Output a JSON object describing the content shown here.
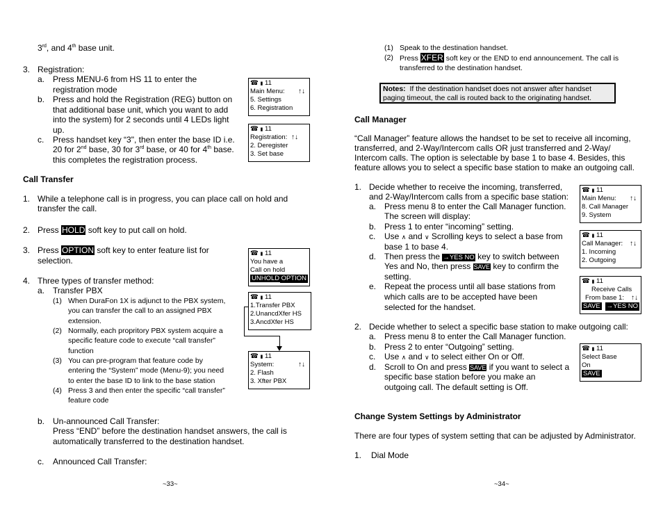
{
  "left_page": {
    "intro_line": {
      "prefix": "3",
      "sup1": "rd",
      "mid": ", and 4",
      "sup2": "th",
      "suffix": " base unit."
    },
    "registration": {
      "num": "3.",
      "title": "Registration:",
      "a": {
        "label": "a.",
        "lines": [
          "Press MENU-6 from HS 11 to enter the",
          "registration mode"
        ]
      },
      "b": {
        "label": "b.",
        "lines": [
          "Press and hold the Registration (REG) button on",
          "that additional base unit, which you want to add",
          "into the system) for 2 seconds until 4 LEDs light",
          "up."
        ]
      },
      "c": {
        "label": "c.",
        "line1": "Press handset key “3\", then enter the base ID i.e.",
        "line2": {
          "t1": "20 for 2",
          "s1": "nd",
          "t2": " base, 30 for 3",
          "s2": "rd",
          "t3": " base, or 40 for 4",
          "s3": "th",
          "t4": " base."
        },
        "line3": "this completes the registration process."
      }
    },
    "call_transfer": {
      "heading": "Call Transfer",
      "item1": {
        "num": "1.",
        "lines": [
          " While a telephone call is in progress, you can place call on hold and",
          "transfer the call."
        ]
      },
      "item2": {
        "num": "2.",
        "pre": "Press ",
        "key": "HOLD",
        "post": " soft key to put call on hold."
      },
      "item3": {
        "num": "3.",
        "pre": "Press ",
        "key": "OPTION",
        "post": " soft key to enter feature list for",
        "line2": "selection."
      },
      "item4": {
        "num": "4.",
        "text": "Three types of transfer method:"
      },
      "a": {
        "label": "a.",
        "title": "Transfer PBX",
        "subs": [
          {
            "num": "(1)",
            "lines": [
              "When DuraFon 1X is adjunct to the PBX system,",
              "you can transfer the call to an assigned PBX",
              "extension."
            ]
          },
          {
            "num": "(2)",
            "lines": [
              "Normally, each propritory PBX system acquire a",
              "specific feature code to execute “call transfer”",
              "function"
            ]
          },
          {
            "num": "(3)",
            "lines": [
              "You can pre-program that feature code by",
              "entering the “System” mode (Menu-9); you need",
              "to enter the base ID to link to the base station"
            ]
          },
          {
            "num": "(4)",
            "lines": [
              "Press 3 and then enter the specific “call transfer”",
              "feature code"
            ]
          }
        ]
      },
      "b": {
        "label": "b.",
        "title": "Un-announced Call Transfer:",
        "lines": [
          "Press “END” before the destination handset answers, the call is",
          "automatically transferred to the destination handset."
        ]
      },
      "c": {
        "label": "c.",
        "title": "Announced Call Transfer:"
      }
    },
    "page_number": "~33~"
  },
  "right_page": {
    "announced_steps": [
      {
        "num": "(1)",
        "text": "Speak to the destination handset."
      },
      {
        "num": "(2)",
        "pre": "Press ",
        "key": "XFER",
        "post": " soft key or the END to end announcement. The call is",
        "line2": "transferred to the destination handset."
      }
    ],
    "notes": {
      "label": "Notes:",
      "text1": "  If the destination handset does not answer after handset",
      "text2": "paging timeout, the call is routed back to the originating handset."
    },
    "call_manager": {
      "heading": "Call Manager",
      "para": [
        "“Call Manager” feature allows the handset to be set to receive all incoming,",
        "transferred, and 2-Way/Intercom calls OR just transferred and 2-Way/",
        "Intercom calls. The option is selectable by base 1 to base 4.  Besides, this",
        "feature allows you to select a specific base station to make an outgoing call."
      ],
      "item1": {
        "num": "1.",
        "lines": [
          "Decide whether to receive the incoming, transferred,",
          "and 2-Way/Intercom calls from a specific base station:"
        ],
        "a": {
          "label": "a.",
          "lines": [
            "Press menu 8 to enter the Call Manager function.",
            "The screen will display:"
          ]
        },
        "b": {
          "label": "b.",
          "text": "Press 1 to enter “incoming” setting."
        },
        "c": {
          "label": "c.",
          "pre": "Use ",
          "up": "∧",
          "mid": " and ",
          "down": "∨",
          "post": " Scrolling keys to select a base from",
          "line2": "base 1 to base 4."
        },
        "d": {
          "label": "d.",
          "pre": "Then press the ",
          "key1": "→YES NO",
          "post": " key to switch between",
          "line2pre": "Yes and No, then press ",
          "key2": "SAVE",
          "line2post": " key to confirm the",
          "line3": "setting."
        },
        "e": {
          "label": "e.",
          "lines": [
            "Repeat the process until all base stations from",
            "which calls are to be accepted have been",
            "selected for the handset."
          ]
        }
      },
      "item2": {
        "num": "2.",
        "text": "Decide whether to select a specific base station to make outgoing call:",
        "a": {
          "label": "a.",
          "text": "Press menu 8 to enter the Call Manager function."
        },
        "b": {
          "label": "b.",
          "text": "Press 2 to enter “Outgoing” setting."
        },
        "c": {
          "label": "c.",
          "pre": "Use ",
          "up": "∧",
          "mid": " and ",
          "down": "∨",
          "post": " to select either On or Off."
        },
        "d": {
          "label": "d.",
          "pre": "Scroll to On and press ",
          "key": "SAVE",
          "post": " if you want to select a",
          "lines": [
            "specific base station before you make an",
            "outgoing call.  The default setting is Off."
          ]
        }
      }
    },
    "system_settings": {
      "heading": "Change System Settings by Administrator",
      "para": "There are four types of system setting that can be adjusted by Administrator.",
      "item1": {
        "num": "1.",
        "text": "Dial Mode"
      }
    },
    "page_number": "~34~"
  },
  "lcd_screens": {
    "status": {
      "phone_icon": "☎",
      "battery_icon": "▮",
      "hs": "11"
    },
    "arrows": "↑↓",
    "main_menu_reg": {
      "rows": [
        "Main Menu:",
        "5. Settings",
        "6. Registration"
      ]
    },
    "registration": {
      "rows": [
        "Registration:",
        "2. Deregister",
        "3. Set base"
      ]
    },
    "call_on_hold": {
      "rows": [
        "You have a",
        "Call on hold"
      ],
      "softkeys": [
        "UNHOLD",
        "OPTION"
      ]
    },
    "transfer_list": {
      "rows": [
        "1.Transfer PBX",
        "2.UnancdXfer HS",
        "3.AncdXfer HS"
      ]
    },
    "system": {
      "rows": [
        "System:",
        "2. Flash",
        "3. Xfter PBX"
      ]
    },
    "main_menu_cm": {
      "rows": [
        "Main Menu:",
        "8. Call Manager",
        "9. System"
      ]
    },
    "call_manager": {
      "rows": [
        "Call Manager:",
        "1. Incoming",
        "2. Outgoing"
      ]
    },
    "receive_calls": {
      "rows": [
        "Receive Calls",
        "From base 1:"
      ],
      "softkeys": [
        "SAVE",
        "→YES NO"
      ]
    },
    "select_base": {
      "rows": [
        "Select Base",
        "On"
      ],
      "softkeys": [
        "SAVE"
      ]
    }
  }
}
